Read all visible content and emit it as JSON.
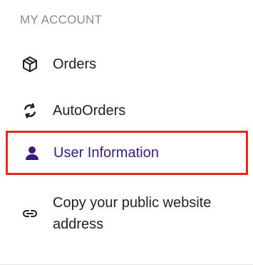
{
  "section": {
    "title": "MY ACCOUNT"
  },
  "menu": {
    "items": [
      {
        "label": "Orders",
        "icon": "package-icon"
      },
      {
        "label": "AutoOrders",
        "icon": "refresh-icon"
      },
      {
        "label": "User Information",
        "icon": "user-icon",
        "selected": true
      },
      {
        "label": "Copy your public website address",
        "icon": "link-icon"
      }
    ]
  },
  "colors": {
    "title": "#8a8a8a",
    "text": "#222222",
    "selected_text": "#3a1d7a",
    "highlight_border": "#e8281b"
  }
}
